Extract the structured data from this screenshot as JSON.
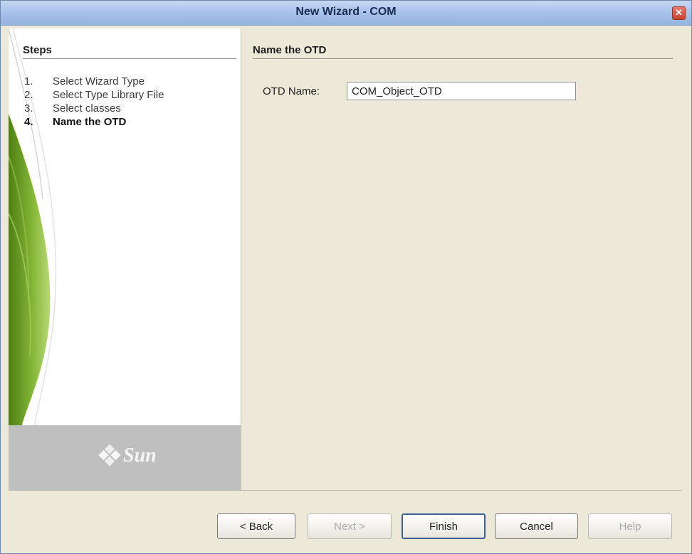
{
  "window": {
    "title": "New Wizard - COM",
    "close_glyph": "✕"
  },
  "steps": {
    "title": "Steps",
    "items": [
      {
        "number": "1.",
        "label": "Select Wizard Type"
      },
      {
        "number": "2.",
        "label": "Select Type Library File"
      },
      {
        "number": "3.",
        "label": "Select classes"
      },
      {
        "number": "4.",
        "label": "Name the OTD",
        "current": true
      }
    ]
  },
  "branding": {
    "logo_text": "Sun",
    "icon": "sun-logo-icon"
  },
  "panel": {
    "title": "Name the OTD",
    "otd_name_label": "OTD Name:",
    "otd_name_value": "COM_Object_OTD"
  },
  "buttons": {
    "back": "< Back",
    "next": "Next >",
    "finish": "Finish",
    "cancel": "Cancel",
    "help": "Help"
  },
  "colors": {
    "title_bar": "#a9c3ea",
    "leaf_green": "#6c9a22",
    "sun_panel": "#bfbfbf"
  }
}
